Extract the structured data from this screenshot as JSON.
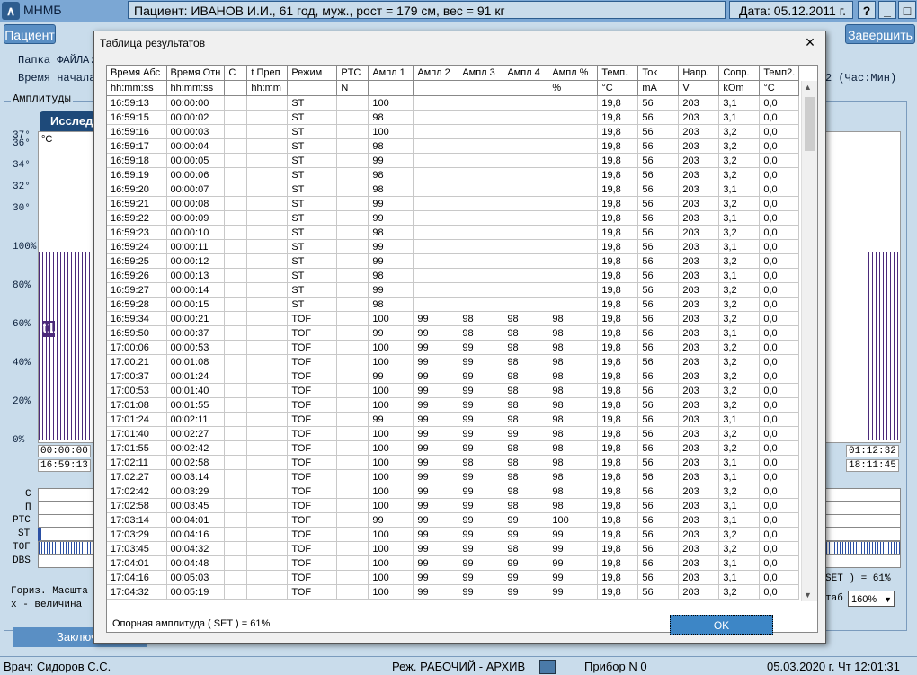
{
  "window": {
    "app_title": "МНМБ",
    "patient": "Пациент:  ИВАНОВ И.И., 61 год, муж., рост = 179 см, вес = 91 кг",
    "date": "Дата:  05.12.2011 г.",
    "help": "?",
    "minimize": "_",
    "maximize": "□"
  },
  "menu": {
    "patient_button": "Пациент",
    "exit_button": "Завершить"
  },
  "info": {
    "file_folder": "Папка ФАЙЛА:",
    "start_time": "Время начала",
    "right_hint": "2 (Час:Мин)"
  },
  "background": {
    "amplitude_label": "Амплитуды",
    "tab_label": "Исследо",
    "unit": "°С",
    "y_labels": [
      "37°",
      "36°",
      "34°",
      "32°",
      "30°",
      "100%",
      "80%",
      "60%",
      "40%",
      "20%",
      "0%"
    ],
    "time_left_top": "00:00:00",
    "time_left_bottom": "16:59:13",
    "time_right_top": "01:12:32",
    "time_right_bottom": "18:11:45",
    "row_labels": [
      "C",
      "П",
      "PTC",
      "ST",
      "TOF",
      "DBS"
    ],
    "horiz_scale": "Гориз. Масшта",
    "x_value": "x - величина",
    "set_text": "SET ) = 61%",
    "scale_label": "таб",
    "scale_value": "160%",
    "conclusion_button": "Заключе",
    "t1_label": "t1"
  },
  "dialog": {
    "title": "Таблица результатов",
    "close_icon": "×",
    "footer_text": "Опорная амплитуда ( SET ) = 61%",
    "ok_button": "OK",
    "columns": [
      "Время Абс",
      "Время Отн",
      "С",
      "t Преп",
      "Режим",
      "PTC",
      "Ампл 1",
      "Ампл 2",
      "Ампл 3",
      "Ампл 4",
      "Ампл %",
      "Темп.",
      "Ток",
      "Напр.",
      "Сопр.",
      "Темп2."
    ],
    "units": [
      "hh:mm:ss",
      "hh:mm:ss",
      "",
      "hh:mm",
      "",
      "N",
      "",
      "",
      "",
      "",
      "%",
      "°C",
      "mA",
      "V",
      "kOm",
      "°C"
    ],
    "rows": [
      [
        "16:59:13",
        "00:00:00",
        "",
        "",
        "ST",
        "",
        "100",
        "",
        "",
        "",
        "",
        "19,8",
        "56",
        "203",
        "3,1",
        "0,0"
      ],
      [
        "16:59:15",
        "00:00:02",
        "",
        "",
        "ST",
        "",
        "98",
        "",
        "",
        "",
        "",
        "19,8",
        "56",
        "203",
        "3,1",
        "0,0"
      ],
      [
        "16:59:16",
        "00:00:03",
        "",
        "",
        "ST",
        "",
        "100",
        "",
        "",
        "",
        "",
        "19,8",
        "56",
        "203",
        "3,2",
        "0,0"
      ],
      [
        "16:59:17",
        "00:00:04",
        "",
        "",
        "ST",
        "",
        "98",
        "",
        "",
        "",
        "",
        "19,8",
        "56",
        "203",
        "3,2",
        "0,0"
      ],
      [
        "16:59:18",
        "00:00:05",
        "",
        "",
        "ST",
        "",
        "99",
        "",
        "",
        "",
        "",
        "19,8",
        "56",
        "203",
        "3,2",
        "0,0"
      ],
      [
        "16:59:19",
        "00:00:06",
        "",
        "",
        "ST",
        "",
        "98",
        "",
        "",
        "",
        "",
        "19,8",
        "56",
        "203",
        "3,2",
        "0,0"
      ],
      [
        "16:59:20",
        "00:00:07",
        "",
        "",
        "ST",
        "",
        "98",
        "",
        "",
        "",
        "",
        "19,8",
        "56",
        "203",
        "3,1",
        "0,0"
      ],
      [
        "16:59:21",
        "00:00:08",
        "",
        "",
        "ST",
        "",
        "99",
        "",
        "",
        "",
        "",
        "19,8",
        "56",
        "203",
        "3,2",
        "0,0"
      ],
      [
        "16:59:22",
        "00:00:09",
        "",
        "",
        "ST",
        "",
        "99",
        "",
        "",
        "",
        "",
        "19,8",
        "56",
        "203",
        "3,1",
        "0,0"
      ],
      [
        "16:59:23",
        "00:00:10",
        "",
        "",
        "ST",
        "",
        "98",
        "",
        "",
        "",
        "",
        "19,8",
        "56",
        "203",
        "3,2",
        "0,0"
      ],
      [
        "16:59:24",
        "00:00:11",
        "",
        "",
        "ST",
        "",
        "99",
        "",
        "",
        "",
        "",
        "19,8",
        "56",
        "203",
        "3,1",
        "0,0"
      ],
      [
        "16:59:25",
        "00:00:12",
        "",
        "",
        "ST",
        "",
        "99",
        "",
        "",
        "",
        "",
        "19,8",
        "56",
        "203",
        "3,2",
        "0,0"
      ],
      [
        "16:59:26",
        "00:00:13",
        "",
        "",
        "ST",
        "",
        "98",
        "",
        "",
        "",
        "",
        "19,8",
        "56",
        "203",
        "3,1",
        "0,0"
      ],
      [
        "16:59:27",
        "00:00:14",
        "",
        "",
        "ST",
        "",
        "99",
        "",
        "",
        "",
        "",
        "19,8",
        "56",
        "203",
        "3,2",
        "0,0"
      ],
      [
        "16:59:28",
        "00:00:15",
        "",
        "",
        "ST",
        "",
        "98",
        "",
        "",
        "",
        "",
        "19,8",
        "56",
        "203",
        "3,2",
        "0,0"
      ],
      [
        "16:59:34",
        "00:00:21",
        "",
        "",
        "TOF",
        "",
        "100",
        "99",
        "98",
        "98",
        "98",
        "19,8",
        "56",
        "203",
        "3,2",
        "0,0"
      ],
      [
        "16:59:50",
        "00:00:37",
        "",
        "",
        "TOF",
        "",
        "99",
        "99",
        "98",
        "98",
        "98",
        "19,8",
        "56",
        "203",
        "3,1",
        "0,0"
      ],
      [
        "17:00:06",
        "00:00:53",
        "",
        "",
        "TOF",
        "",
        "100",
        "99",
        "99",
        "98",
        "98",
        "19,8",
        "56",
        "203",
        "3,2",
        "0,0"
      ],
      [
        "17:00:21",
        "00:01:08",
        "",
        "",
        "TOF",
        "",
        "100",
        "99",
        "99",
        "98",
        "98",
        "19,8",
        "56",
        "203",
        "3,2",
        "0,0"
      ],
      [
        "17:00:37",
        "00:01:24",
        "",
        "",
        "TOF",
        "",
        "99",
        "99",
        "99",
        "98",
        "98",
        "19,8",
        "56",
        "203",
        "3,2",
        "0,0"
      ],
      [
        "17:00:53",
        "00:01:40",
        "",
        "",
        "TOF",
        "",
        "100",
        "99",
        "99",
        "98",
        "98",
        "19,8",
        "56",
        "203",
        "3,2",
        "0,0"
      ],
      [
        "17:01:08",
        "00:01:55",
        "",
        "",
        "TOF",
        "",
        "100",
        "99",
        "99",
        "98",
        "98",
        "19,8",
        "56",
        "203",
        "3,2",
        "0,0"
      ],
      [
        "17:01:24",
        "00:02:11",
        "",
        "",
        "TOF",
        "",
        "99",
        "99",
        "99",
        "98",
        "98",
        "19,8",
        "56",
        "203",
        "3,1",
        "0,0"
      ],
      [
        "17:01:40",
        "00:02:27",
        "",
        "",
        "TOF",
        "",
        "100",
        "99",
        "99",
        "99",
        "98",
        "19,8",
        "56",
        "203",
        "3,2",
        "0,0"
      ],
      [
        "17:01:55",
        "00:02:42",
        "",
        "",
        "TOF",
        "",
        "100",
        "99",
        "99",
        "98",
        "98",
        "19,8",
        "56",
        "203",
        "3,2",
        "0,0"
      ],
      [
        "17:02:11",
        "00:02:58",
        "",
        "",
        "TOF",
        "",
        "100",
        "99",
        "98",
        "98",
        "98",
        "19,8",
        "56",
        "203",
        "3,1",
        "0,0"
      ],
      [
        "17:02:27",
        "00:03:14",
        "",
        "",
        "TOF",
        "",
        "100",
        "99",
        "99",
        "98",
        "98",
        "19,8",
        "56",
        "203",
        "3,1",
        "0,0"
      ],
      [
        "17:02:42",
        "00:03:29",
        "",
        "",
        "TOF",
        "",
        "100",
        "99",
        "99",
        "98",
        "98",
        "19,8",
        "56",
        "203",
        "3,2",
        "0,0"
      ],
      [
        "17:02:58",
        "00:03:45",
        "",
        "",
        "TOF",
        "",
        "100",
        "99",
        "99",
        "98",
        "98",
        "19,8",
        "56",
        "203",
        "3,1",
        "0,0"
      ],
      [
        "17:03:14",
        "00:04:01",
        "",
        "",
        "TOF",
        "",
        "99",
        "99",
        "99",
        "99",
        "100",
        "19,8",
        "56",
        "203",
        "3,1",
        "0,0"
      ],
      [
        "17:03:29",
        "00:04:16",
        "",
        "",
        "TOF",
        "",
        "100",
        "99",
        "99",
        "99",
        "99",
        "19,8",
        "56",
        "203",
        "3,2",
        "0,0"
      ],
      [
        "17:03:45",
        "00:04:32",
        "",
        "",
        "TOF",
        "",
        "100",
        "99",
        "99",
        "98",
        "99",
        "19,8",
        "56",
        "203",
        "3,2",
        "0,0"
      ],
      [
        "17:04:01",
        "00:04:48",
        "",
        "",
        "TOF",
        "",
        "100",
        "99",
        "99",
        "99",
        "99",
        "19,8",
        "56",
        "203",
        "3,1",
        "0,0"
      ],
      [
        "17:04:16",
        "00:05:03",
        "",
        "",
        "TOF",
        "",
        "100",
        "99",
        "99",
        "99",
        "99",
        "19,8",
        "56",
        "203",
        "3,1",
        "0,0"
      ],
      [
        "17:04:32",
        "00:05:19",
        "",
        "",
        "TOF",
        "",
        "100",
        "99",
        "99",
        "99",
        "99",
        "19,8",
        "56",
        "203",
        "3,2",
        "0,0"
      ]
    ]
  },
  "statusbar": {
    "doctor": "Врач: Сидоров С.С.",
    "mode": "Реж. РАБОЧИЙ - АРХИВ",
    "device": "Прибор N 0",
    "datetime": "05.03.2020 г.  Чт  12:01:31"
  }
}
